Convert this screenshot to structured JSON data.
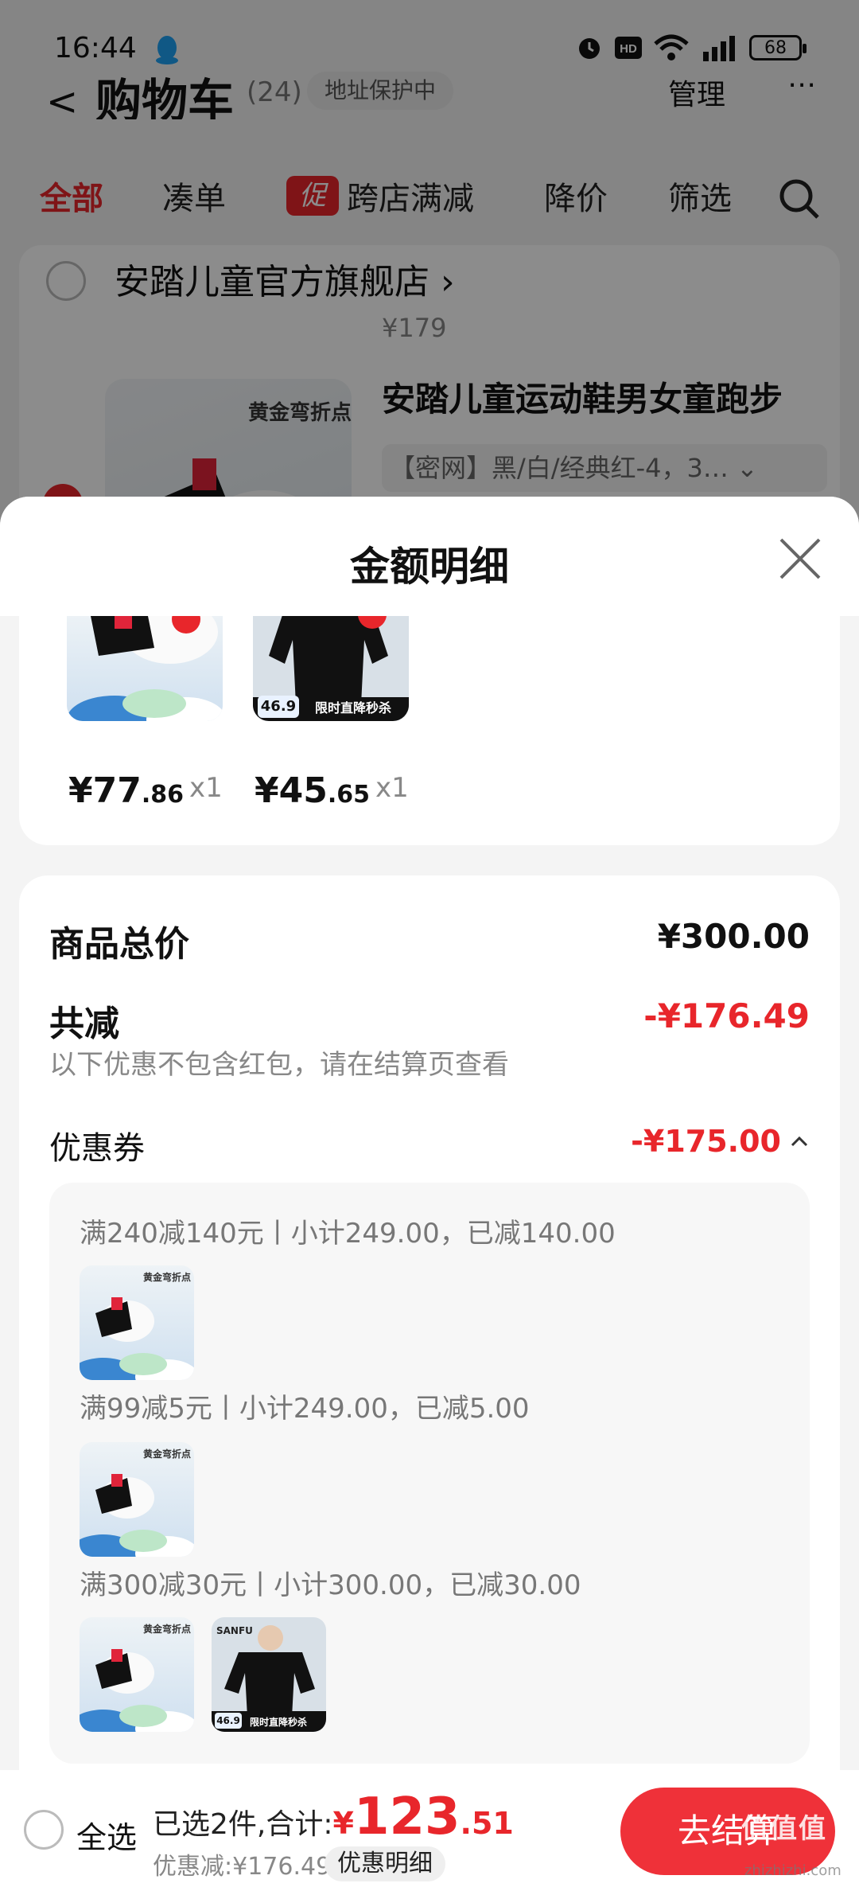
{
  "status_bar": {
    "time": "16:44",
    "battery": "68"
  },
  "cart_header": {
    "back": "<",
    "title": "购物车",
    "count": "(24)",
    "address_chip": "地址保护中",
    "manage": "管理",
    "more": "⋯"
  },
  "filter_tabs": {
    "all": "全部",
    "bundle": "凑单",
    "promo_badge": "促",
    "cross_store": "跨店满减",
    "price_drop": "降价",
    "filter": "筛选"
  },
  "background_card": {
    "shop_name": "安踏儿童官方旗舰店 ›",
    "old_price": "¥179",
    "product_tag": "黄金弯折点",
    "product_title": "安踏儿童运动鞋男女童跑步",
    "product_sku": "【密网】黑/白/经典红-4，3…  ⌄"
  },
  "sheet": {
    "title": "金额明细",
    "items": [
      {
        "price_int": "¥77",
        "price_dec": ".86",
        "qty": "x1"
      },
      {
        "price_int": "¥45",
        "price_dec": ".65",
        "qty": "x1",
        "badge": "46.9",
        "banner": "限时直降秒杀"
      }
    ],
    "total_label": "商品总价",
    "total_value": "¥300.00",
    "reduce_label": "共减",
    "reduce_value": "-¥176.49",
    "note": "以下优惠不包含红包，请在结算页查看",
    "coupon_label": "优惠券",
    "coupon_value": "-¥175.00",
    "coupon_rules": [
      "满240减140元丨小计249.00，已减140.00",
      "满99减5元丨小计249.00，已减5.00",
      "满300减30元丨小计300.00，已减30.00"
    ],
    "thumb_tag": "黄金弯折点",
    "thumb_badge": "46.9",
    "thumb_banner": "限时直降秒杀",
    "thumb_brand": "SANFU"
  },
  "bottom_bar": {
    "select_all": "全选",
    "summary_prefix": "已选2件,合计:",
    "total_currency": "¥",
    "total_int": "123",
    "total_dec": ".51",
    "discount": "优惠减:¥176.49",
    "detail_chip": "优惠明细",
    "checkout": "去结算"
  },
  "watermark": {
    "text": "值值值",
    "url": "zhizhizhi.com"
  }
}
